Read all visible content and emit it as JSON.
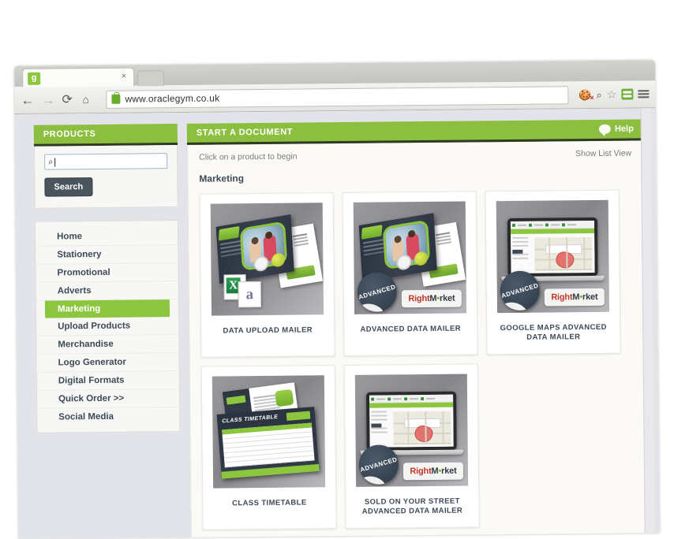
{
  "browser": {
    "tab_title": "",
    "favicon_glyph": "g",
    "close_label": "×",
    "url": "www.oraclegym.co.uk",
    "back_glyph": "←",
    "forward_glyph": "→",
    "reload_glyph": "⟳",
    "home_glyph": "⌂",
    "cookie_x": "×",
    "magnifier_glyph": "⌕",
    "star_glyph": "☆"
  },
  "sidebar": {
    "panel_title": "PRODUCTS",
    "search": {
      "value": "",
      "placeholder": "",
      "icon": "search-icon",
      "icon_glyph": "⌕",
      "button_label": "Search"
    },
    "items": [
      {
        "label": "Home",
        "active": false
      },
      {
        "label": "Stationery",
        "active": false
      },
      {
        "label": "Promotional",
        "active": false
      },
      {
        "label": "Adverts",
        "active": false
      },
      {
        "label": "Marketing",
        "active": true
      },
      {
        "label": "Upload Products",
        "active": false
      },
      {
        "label": "Merchandise",
        "active": false
      },
      {
        "label": "Logo Generator",
        "active": false
      },
      {
        "label": "Digital Formats",
        "active": false
      },
      {
        "label": "Quick Order >>",
        "active": false
      },
      {
        "label": "Social Media",
        "active": false
      }
    ]
  },
  "content": {
    "header_title": "START A DOCUMENT",
    "help_label": "Help",
    "hint": "Click on a product to begin",
    "list_view_label": "Show List View",
    "section_title": "Marketing",
    "products": [
      {
        "label": "DATA UPLOAD MAILER",
        "thumb": "brochure-with-data-icons"
      },
      {
        "label": "ADVANCED DATA MAILER",
        "thumb": "brochure-advanced"
      },
      {
        "label": "GOOGLE MAPS ADVANCED DATA MAILER",
        "thumb": "laptop-map-advanced"
      },
      {
        "label": "CLASS TIMETABLE",
        "thumb": "timetable-flyer"
      },
      {
        "label": "SOLD ON YOUR STREET ADVANCED DATA MAILER",
        "thumb": "laptop-map-advanced"
      }
    ],
    "badges": {
      "advanced": "ADVANCED",
      "rightmarket": {
        "part1": "Right",
        "part2": "M",
        "part3": "•",
        "part4": "rket"
      }
    }
  },
  "colors": {
    "brand_green": "#8cbe3f",
    "dark_green_rule": "#2f3a22",
    "active_nav": "#8cc63e",
    "text_dark": "#3e4b57",
    "page_bg": "#fbfaf7",
    "chrome_bg": "#e2e4e9"
  }
}
